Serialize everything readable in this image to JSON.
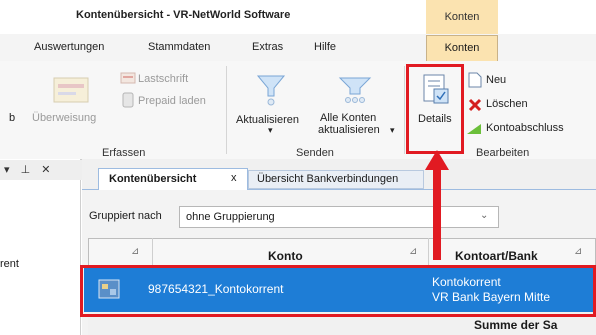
{
  "window": {
    "title": "Kontenübersicht - VR-NetWorld Software",
    "context_tab": "Konten"
  },
  "menubar": {
    "items": [
      "Auswertungen",
      "Stammdaten",
      "Extras",
      "Hilfe",
      "Konten"
    ],
    "active": "Konten"
  },
  "ribbon": {
    "erfassen": {
      "label": "Erfassen",
      "partial_letter": "b",
      "ueberweisung": "Überweisung",
      "lastschrift": "Lastschrift",
      "prepaid": "Prepaid laden"
    },
    "senden": {
      "label": "Senden",
      "aktualisieren": "Aktualisieren",
      "alle_line1": "Alle Konten",
      "alle_line2": "aktualisieren"
    },
    "bearbeiten": {
      "label": "Bearbeiten",
      "details": "Details",
      "neu": "Neu",
      "loeschen": "Löschen",
      "kontoabschluss": "Kontoabschluss"
    }
  },
  "left_pane": {
    "controls": "▾ ⊥ ✕",
    "item_partial": "rent"
  },
  "tabs": [
    {
      "label": "Kontenübersicht",
      "close": "x",
      "active": true
    },
    {
      "label": "Übersicht Bankverbindungen",
      "active": false
    }
  ],
  "grouping": {
    "label": "Gruppiert nach",
    "value": "ohne Gruppierung"
  },
  "grid": {
    "columns": [
      "Konto",
      "Kontoart/Bank"
    ],
    "rows": [
      {
        "konto": "987654321_Kontokorrent",
        "kontoart": "Kontokorrent",
        "bank": "VR Bank Bayern Mitte",
        "selected": true
      }
    ],
    "footer": "Summe der Sa"
  },
  "colors": {
    "accent_tab": "#fbe3b0",
    "selection": "#1e7dd6",
    "highlight": "#e11a22"
  }
}
